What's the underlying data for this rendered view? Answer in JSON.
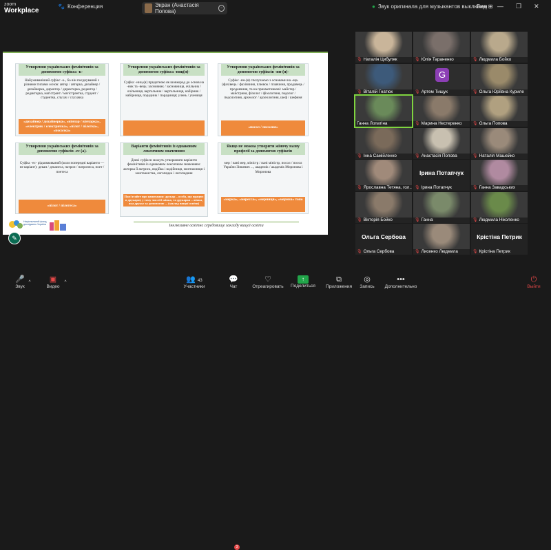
{
  "app": {
    "logo_top": "zoom",
    "logo_bottom": "Workplace"
  },
  "header": {
    "conference": "Конференция",
    "screen_label": "Экран (Анастасія Попова)",
    "original_sound": "Звук оригинала для музыкантов выключен",
    "view": "Вид"
  },
  "slide": {
    "cards": [
      {
        "title": "Утворення українських фемінітивів за допомогою суфікса -к-",
        "body": "Найуживаніший суфікс -к-, бо він поєднуваний з різними типами основ: автор / авторка, дизайнер / дизайнерка, директор / директорка, редактор / редакторка, магістрант / магістрантка, студент / студентка, слухач / слухачка",
        "foot": "«дизайнер / дизайнерка», «вінчар / вінчарка», «електрик / електричка», «пілот / пілотка», «посолка»"
      },
      {
        "title": "Утворення українських фемінітивів за допомогою суфікса -ниц(я)-",
        "body": "Суфікс -ниц-(я) придатною як шовкород до основ на -ник та -вець: засновник / засновниця, очільник / очільниця, вертальник / вертальниця, набірник / набірниця, порадник / порадниця; учень / учениця",
        "foot": ""
      },
      {
        "title": "Утворення українських фемінітивів за допомогою суфіксів -ин-(я)-",
        "body": "Суфікс -ин-(я) сполучаємо з основами на -ець (фахівець / фахівчиня, плювок / плавчиня, продавець / продавчиня, та на прикметникові: майстер / майстриня, фізолог / фізологиня, педолог / педологиня, археолог / археологиня, шеф / шефиня",
        "foot": "«посол / посолня»"
      },
      {
        "title": "Утворення українських фемінітивів за допомогою суфіксів -ес (а)-",
        "body": "Суфікс -ес- рідковживаний (коли попередні варіанти — не варіант): декан / деканеса, патрон / патронеса, поет / поетеса",
        "foot": "«пілот / пілотеса»"
      },
      {
        "title": "Варіанти фемінітивів із однаковим лексичним значенням",
        "body": "Деякі суфікси можуть утворювати варіанти фемінітивів із однаковим лексичним значенням: акторка й актриса, водійка і водійниця, монтажниця і монтажистка, логопедка і логопединя",
        "foot": "Пам'ятайте про напитання: друкар – особа, що працює в друкарні, у тому числі й жінка, та друкарка – жінка, яка друкує за допомогою ... (заклад вищої освіти)"
      },
      {
        "title": "Якщо не можна утворити жіночу назву професії за допомогою суфіксів",
        "body": "мер / пані мер, міністр / пані міністр, посол / посол України Зінкевич ..., академік / академік Миронова і Миронова",
        "foot": "«мерка», «мересса», «мерниця», «мерина» топо"
      }
    ],
    "logo_text": "Національний фонд досліджень Україна",
    "footer": "Інклюзивне освітнє середовище закладу вищої освіти"
  },
  "participants": [
    {
      "name": "Наталія Цибуляк",
      "muted": true
    },
    {
      "name": "Юлія Тараненко",
      "muted": true
    },
    {
      "name": "Людмила Бойко",
      "muted": true
    },
    {
      "name": "Віталій Гнатюк",
      "muted": true
    },
    {
      "name": "Артем Тищук",
      "muted": true,
      "initial": "G"
    },
    {
      "name": "Ольга Юріївна Куриле",
      "muted": true
    },
    {
      "name": "Ганна Лопатіна",
      "muted": false
    },
    {
      "name": "Марина Нестеренко",
      "muted": true
    },
    {
      "name": "Ольга Попова",
      "muted": true
    },
    {
      "name": "Інна Самійленко",
      "muted": true
    },
    {
      "name": "Анастасія Попова",
      "muted": true
    },
    {
      "name": "Наталія Машейко",
      "muted": true
    },
    {
      "name": "Ярославна Тетяна, гол...",
      "muted": true
    },
    {
      "name": "Ірина Потапчук",
      "muted": true,
      "big": "Ірина Потапчук"
    },
    {
      "name": "Ганна Завадських",
      "muted": true
    },
    {
      "name": "Вікторія Бойко",
      "muted": true
    },
    {
      "name": "Ганна",
      "muted": true
    },
    {
      "name": "Людмила Ніколенко",
      "muted": true
    },
    {
      "name": "Ольга Сербова",
      "muted": true,
      "big": "Ольга Сербова"
    },
    {
      "name": "Лисенко Людмила",
      "muted": true
    },
    {
      "name": "Крістіна Петрик",
      "muted": true,
      "big": "Крістіна Петрик"
    }
  ],
  "toolbar": {
    "audio": "Звук",
    "video": "Видео",
    "participants": "Участники",
    "participants_count": "43",
    "chat": "Чат",
    "chat_badge": "3",
    "react": "Отреагировать",
    "share": "Поделиться",
    "apps": "Приложения",
    "record": "Запись",
    "more": "Дополнительно",
    "exit": "Выйти"
  }
}
